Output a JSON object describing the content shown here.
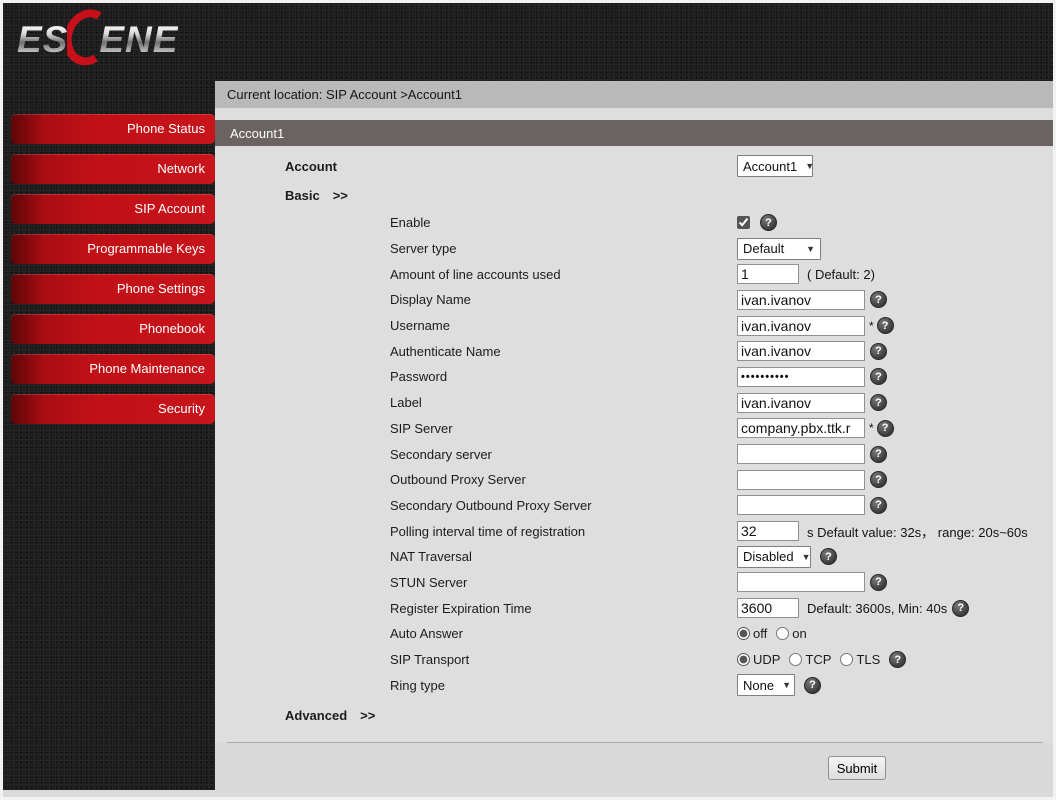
{
  "logo": {
    "part1": "ES",
    "part2": "ENE"
  },
  "sidebar": {
    "items": [
      "Phone Status",
      "Network",
      "SIP Account",
      "Programmable Keys",
      "Phone Settings",
      "Phonebook",
      "Phone Maintenance",
      "Security"
    ]
  },
  "breadcrumb": {
    "text": "Current location: SIP Account >Account1"
  },
  "page": {
    "section_title": "Account1"
  },
  "form": {
    "account": {
      "label": "Account",
      "value": "Account1"
    },
    "basic": {
      "label": "Basic",
      "arrows": ">>"
    },
    "advanced": {
      "label": "Advanced",
      "arrows": ">>"
    },
    "fields": {
      "enable": {
        "label": "Enable",
        "checked": true
      },
      "server_type": {
        "label": "Server type",
        "value": "Default"
      },
      "line_accounts": {
        "label": "Amount of line accounts used",
        "value": "1",
        "note": "( Default: 2)"
      },
      "display_name": {
        "label": "Display Name",
        "value": "ivan.ivanov"
      },
      "username": {
        "label": "Username",
        "value": "ivan.ivanov",
        "required_mark": "*"
      },
      "auth_name": {
        "label": "Authenticate Name",
        "value": "ivan.ivanov"
      },
      "password": {
        "label": "Password",
        "value_masked": "••••••••••"
      },
      "label": {
        "label": "Label",
        "value": "ivan.ivanov"
      },
      "sip_server": {
        "label": "SIP Server",
        "value": "company.pbx.ttk.r",
        "required_mark": "*"
      },
      "secondary_server": {
        "label": "Secondary server",
        "value": ""
      },
      "outbound_proxy": {
        "label": "Outbound Proxy Server",
        "value": ""
      },
      "secondary_outbound_proxy": {
        "label": "Secondary Outbound Proxy Server",
        "value": ""
      },
      "polling_interval": {
        "label": "Polling interval time of registration",
        "value": "32",
        "note": "s Default value: 32s， range: 20s~60s"
      },
      "nat_traversal": {
        "label": "NAT Traversal",
        "value": "Disabled"
      },
      "stun_server": {
        "label": "STUN Server",
        "value": ""
      },
      "register_expiration": {
        "label": "Register Expiration Time",
        "value": "3600",
        "note": "Default: 3600s, Min: 40s"
      },
      "auto_answer": {
        "label": "Auto Answer",
        "options": [
          "off",
          "on"
        ],
        "selected": "off"
      },
      "sip_transport": {
        "label": "SIP Transport",
        "options": [
          "UDP",
          "TCP",
          "TLS"
        ],
        "selected": "UDP"
      },
      "ring_type": {
        "label": "Ring type",
        "value": "None"
      }
    },
    "submit_label": "Submit"
  },
  "colors": {
    "accent_red": "#c21017",
    "title_bar": "#6a6361",
    "breadcrumb_bar": "#b9b9b9",
    "content_bg": "#dedede",
    "dark_bg": "#1d1d1d"
  }
}
